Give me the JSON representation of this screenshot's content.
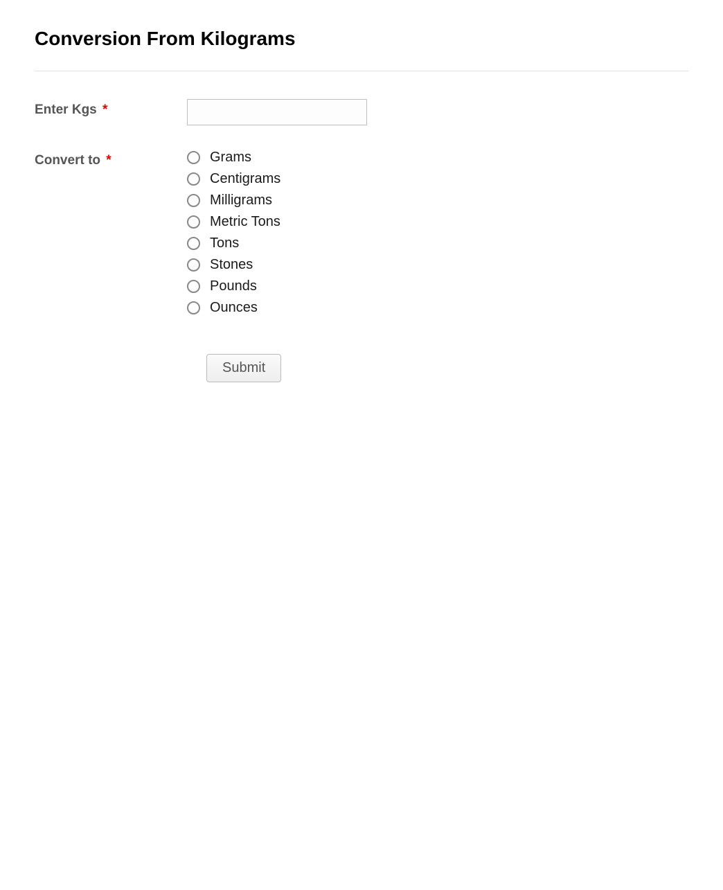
{
  "title": "Conversion From Kilograms",
  "form": {
    "enter_kgs": {
      "label": "Enter Kgs",
      "required_marker": "*",
      "value": ""
    },
    "convert_to": {
      "label": "Convert to",
      "required_marker": "*",
      "options": [
        "Grams",
        "Centigrams",
        "Milligrams",
        "Metric Tons",
        "Tons",
        "Stones",
        "Pounds",
        "Ounces"
      ]
    },
    "submit_label": "Submit"
  }
}
